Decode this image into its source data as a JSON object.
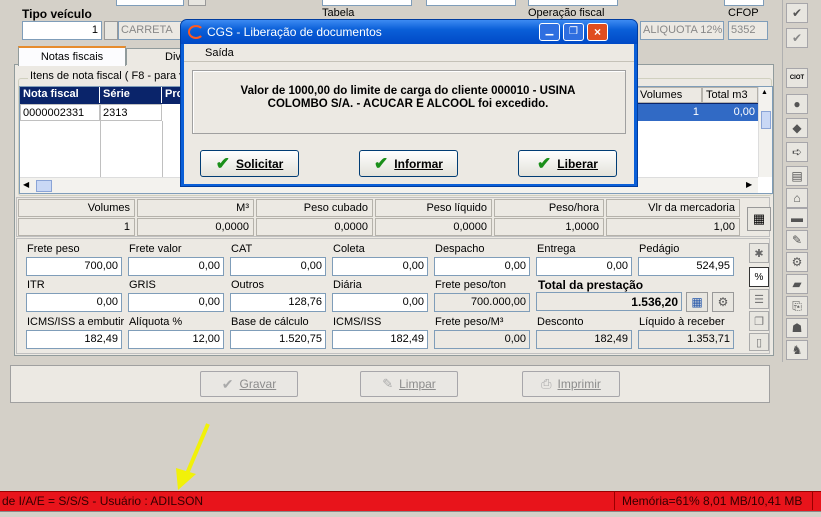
{
  "top": {
    "tipo_veiculo_label": "Tipo veículo",
    "tipo_veiculo_code": "1",
    "tipo_veiculo_name": "CARRETA",
    "tabela_label": "Tabela",
    "operacao_label": "Operação fiscal",
    "operacao_value": "ALIQUOTA 12%",
    "cfop_label": "CFOP",
    "cfop_value": "5352"
  },
  "tabs": {
    "notas": "Notas fiscais",
    "div": "Div"
  },
  "items_caption": "Itens de nota fiscal ( F8 - para vi",
  "grid": {
    "headers": [
      "Nota fiscal",
      "Série",
      "Pro"
    ],
    "right_headers": [
      "Volumes",
      "Total m3"
    ],
    "row": {
      "nota": "0000002331",
      "serie": "2313",
      "volumes": "1",
      "total_m3": "0,00"
    }
  },
  "summary": {
    "headers": [
      "Volumes",
      "M³",
      "Peso cubado",
      "Peso líquido",
      "Peso/hora",
      "Vlr da mercadoria"
    ],
    "values": [
      "1",
      "0,0000",
      "0,0000",
      "0,0000",
      "1,0000",
      "1,00"
    ]
  },
  "calc": {
    "row1": [
      {
        "label": "Frete peso",
        "value": "700,00"
      },
      {
        "label": "Frete valor",
        "value": "0,00"
      },
      {
        "label": "CAT",
        "value": "0,00"
      },
      {
        "label": "Coleta",
        "value": "0,00"
      },
      {
        "label": "Despacho",
        "value": "0,00"
      },
      {
        "label": "Entrega",
        "value": "0,00"
      },
      {
        "label": "Pedágio",
        "value": "524,95"
      }
    ],
    "row2": [
      {
        "label": "ITR",
        "value": "0,00"
      },
      {
        "label": "GRIS",
        "value": "0,00"
      },
      {
        "label": "Outros",
        "value": "128,76"
      },
      {
        "label": "Diária",
        "value": "0,00"
      },
      {
        "label": "Frete peso/ton",
        "value": "700.000,00"
      }
    ],
    "total_label": "Total da prestação",
    "total_value": "1.536,20",
    "row3": [
      {
        "label": "ICMS/ISS a embutir",
        "value": "182,49"
      },
      {
        "label": "Alíquota %",
        "value": "12,00"
      },
      {
        "label": "Base de cálculo",
        "value": "1.520,75"
      },
      {
        "label": "ICMS/ISS",
        "value": "182,49"
      },
      {
        "label": "Frete peso/M³",
        "value": "0,00"
      },
      {
        "label": "Desconto",
        "value": "182,49"
      },
      {
        "label": "Líquido à receber",
        "value": "1.353,71"
      }
    ]
  },
  "actions": {
    "gravar": "Gravar",
    "limpar": "Limpar",
    "imprimir": "Imprimir"
  },
  "status": {
    "left": "de I/A/E = S/S/S - Usuário : ADILSON",
    "right": "Memória=61% 8,01 MB/10,41 MB",
    "color": "#e8141b"
  },
  "dialog": {
    "title": "CGS - Liberação de documentos",
    "menu": "Saída",
    "message": "Valor de 1000,00 do limite de carga do cliente 000010 - USINA COLOMBO S/A. - ACUCAR E ALCOOL foi excedido.",
    "buttons": [
      "Solicitar",
      "Informar",
      "Liberar"
    ],
    "title_color": "#0a5fd8"
  },
  "sidebar_icons": [
    "check-icon",
    "ciot-icon",
    "circle-icon",
    "leaf-icon",
    "document-arrow-icon",
    "document-icon",
    "tag-icon",
    "bus-icon",
    "speech-icon",
    "gear-icon",
    "truck-icon",
    "stamp-icon",
    "mug-icon",
    "puzzle-icon",
    "bell-icon"
  ]
}
